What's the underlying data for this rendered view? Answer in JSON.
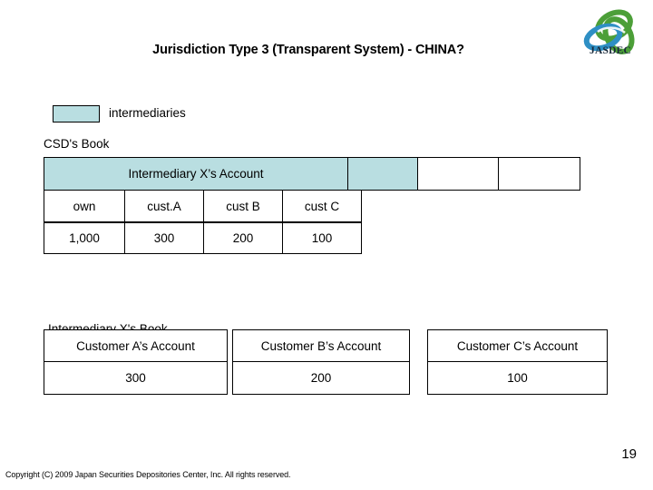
{
  "slide": {
    "title": "Jurisdiction Type 3 (Transparent System) - CHINA?",
    "page_number": "19",
    "copyright": "Copyright (C) 2009 Japan Securities Depositories Center, Inc.  All rights reserved."
  },
  "logo": {
    "wordmark": "JASDEC",
    "blue": "#2e8fc4",
    "green": "#4c9f38"
  },
  "legend": {
    "swatch_color": "#b9dee1",
    "label": "intermediaries"
  },
  "csd_book": {
    "label": "CSD's Book",
    "header": "Intermediary X’s Account",
    "extra_cells": [
      "",
      "",
      ""
    ],
    "columns": [
      "own",
      "cust.A",
      "cust B",
      "cust C"
    ],
    "values": [
      "1,000",
      "300",
      "200",
      "100"
    ]
  },
  "intermediary_book": {
    "label": "Intermediary X's Book",
    "accounts": [
      {
        "header": "Customer A’s Account",
        "value": "300"
      },
      {
        "header": "Customer B’s Account",
        "value": "200"
      },
      {
        "header": "Customer C’s Account",
        "value": "100"
      }
    ]
  }
}
